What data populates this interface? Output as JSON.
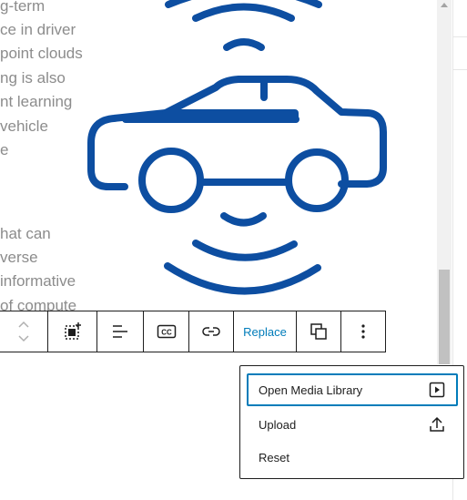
{
  "background_text": {
    "lines": [
      "g-term",
      "ce in driver",
      "point clouds",
      "ng is also",
      "nt learning",
      "vehicle",
      "e",
      "",
      "",
      "hat can",
      "verse",
      "informative",
      "of compute"
    ]
  },
  "image": {
    "icon": "connected-car-icon",
    "color": "#0d4ea1"
  },
  "toolbar": {
    "buttons": [
      "move-up-down-icon",
      "select-parent-icon",
      "align-icon",
      "caption-icon",
      "link-icon",
      "replace",
      "duplicate-icon",
      "more-options-icon"
    ],
    "replace_label": "Replace"
  },
  "dropdown": {
    "items": [
      {
        "label": "Open Media Library",
        "icon": "media-library-icon"
      },
      {
        "label": "Upload",
        "icon": "upload-icon"
      },
      {
        "label": "Reset",
        "icon": ""
      }
    ]
  },
  "colors": {
    "accent": "#007cba",
    "icon_blue": "#0d4ea1",
    "text_gray": "#8c8c8c",
    "border": "#1e1e1e"
  }
}
